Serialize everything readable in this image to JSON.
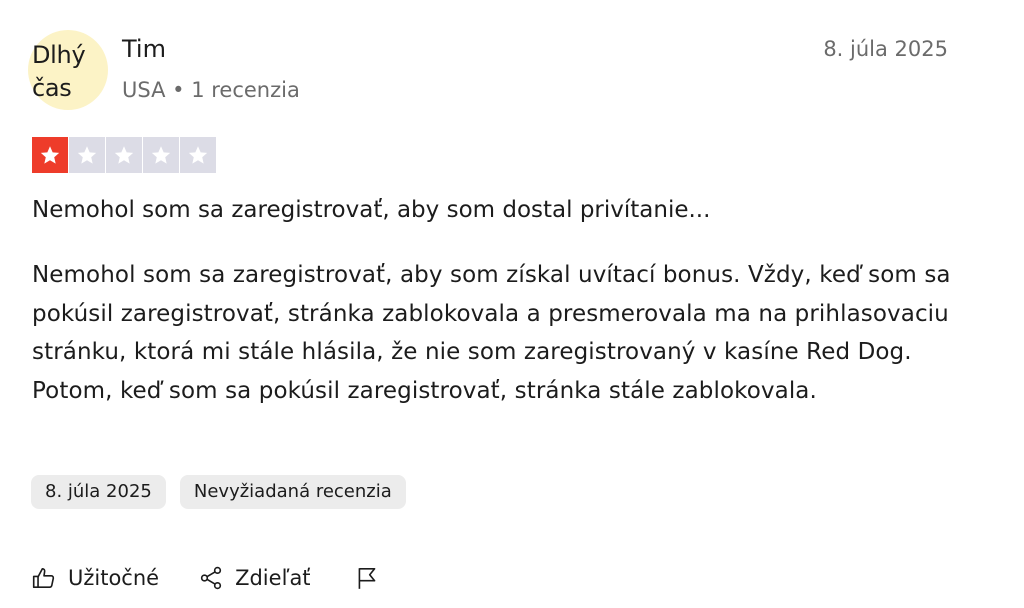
{
  "reviewer": {
    "avatar_text": "Dlhý\nčas",
    "name": "Tim",
    "meta": "USA • 1 recenzia"
  },
  "review": {
    "date": "8. júla 2025",
    "rating": 1,
    "max_rating": 5,
    "title": "Nemohol som sa zaregistrovať, aby som dostal privítanie...",
    "body": "Nemohol som sa zaregistrovať, aby som získal uvítací bonus. Vždy, keď som sa pokúsil zaregistrovať, stránka zablokovala a presmerovala ma na prihlasovaciu stránku, ktorá mi stále hlásila, že nie som zaregistrovaný v kasíne Red Dog. Potom, keď som sa pokúsil zaregistrovať, stránka stále zablokovala."
  },
  "chips": {
    "date": "8. júla 2025",
    "type": "Nevyžiadaná recenzia"
  },
  "actions": {
    "helpful_label": "Užitočné",
    "share_label": "Zdieľať",
    "helpful_icon": "thumbs-up-icon",
    "share_icon": "share-icon",
    "report_icon": "flag-icon"
  },
  "colors": {
    "star_filled": "#ee3c2a",
    "star_empty": "#dcdce6",
    "avatar_bg": "#fcf3c6",
    "chip_bg": "#ececec",
    "muted_text": "#6b6b6b"
  }
}
